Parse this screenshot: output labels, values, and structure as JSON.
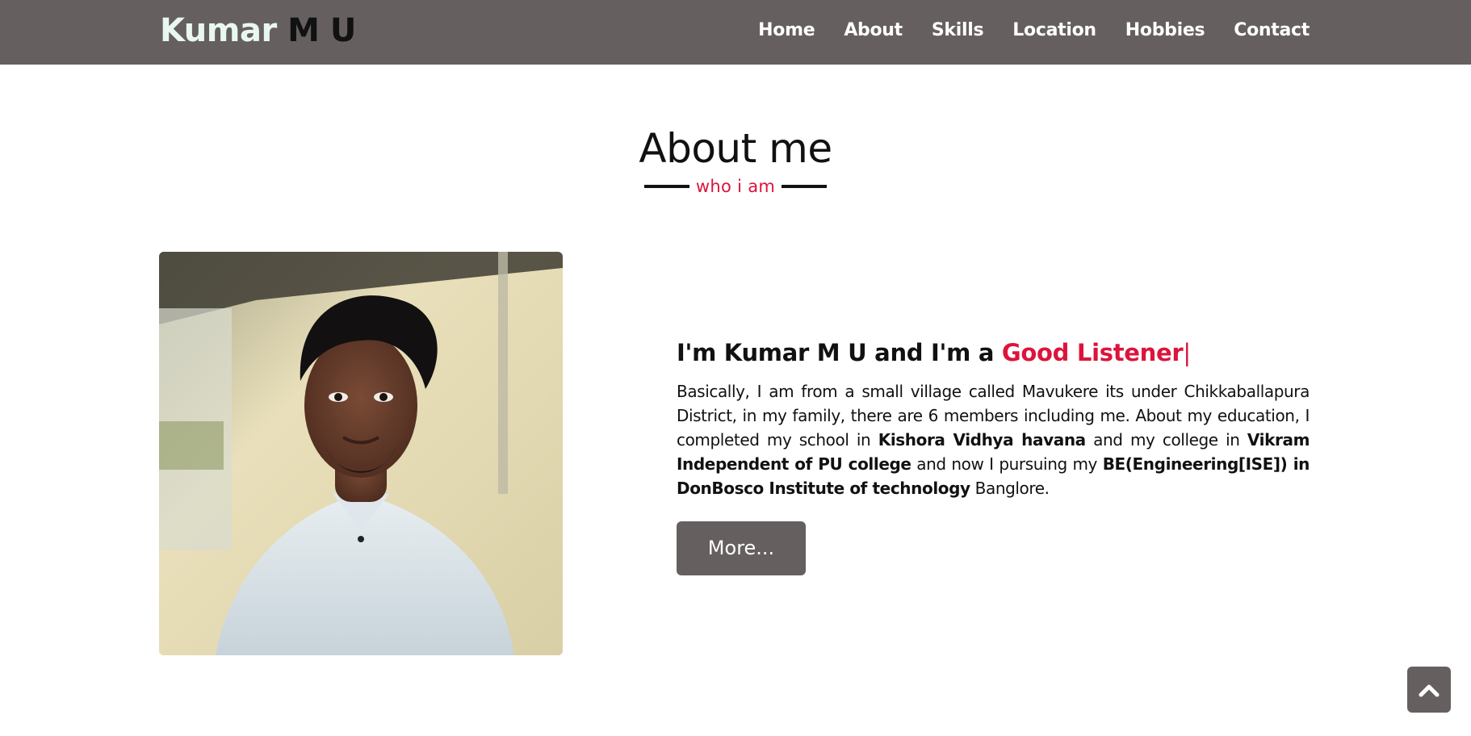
{
  "navbar": {
    "logo_first": "Kumar",
    "logo_last": "M U",
    "items": [
      {
        "label": "Home"
      },
      {
        "label": "About"
      },
      {
        "label": "Skills"
      },
      {
        "label": "Location"
      },
      {
        "label": "Hobbies"
      },
      {
        "label": "Contact"
      }
    ]
  },
  "about": {
    "title": "About me",
    "subtitle": "who i am",
    "intro_prefix": "I'm Kumar M U and I'm a",
    "intro_highlight": "Good Listener",
    "intro_cursor": "|",
    "bio": {
      "t1": "Basically, I am from a small village called Mavukere its under Chikkaballapura District, in my family, there are 6 members including me. About my education, I completed my school in",
      "b1": "Kishora Vidhya havana",
      "t2": "and my college in",
      "b2": "Vikram Independent of PU college",
      "t3": "and now I pursuing my",
      "b3": "BE(Engineering[ISE]) in DonBosco Institute of technology",
      "t4": "Banglore."
    },
    "more_button": "More..."
  },
  "icons": {
    "scroll_top": "chevron-up-icon"
  },
  "colors": {
    "navbar_bg": "#665f60",
    "accent": "#dc143c",
    "logo_first": "#e9f7f1"
  }
}
